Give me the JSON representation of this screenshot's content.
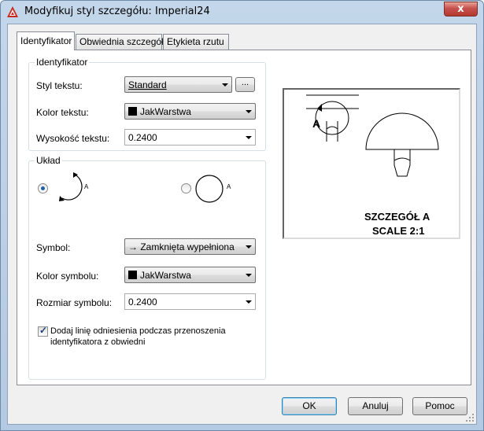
{
  "window": {
    "title": "Modyfikuj styl szczegółu: Imperial24",
    "close_glyph": "x"
  },
  "tabs": [
    {
      "label": "Identyfikator",
      "active": true
    },
    {
      "label": "Obwiednia szczegółu",
      "active": false
    },
    {
      "label": "Etykieta rzutu",
      "active": false
    }
  ],
  "identifier_group": {
    "title": "Identyfikator",
    "text_style_label": "Styl tekstu:",
    "text_style_value": "Standard",
    "browse_label": "...",
    "text_color_label": "Kolor tekstu:",
    "text_color_value": "JakWarstwa",
    "text_height_label": "Wysokość tekstu:",
    "text_height_value": "0.2400"
  },
  "layout_group": {
    "title": "Układ",
    "option1_selected": true,
    "option1_letter": "A",
    "option2_selected": false,
    "option2_letter": "A",
    "symbol_label": "Symbol:",
    "symbol_value": "Zamknięta wypełniona",
    "symbol_color_label": "Kolor symbolu:",
    "symbol_color_value": "JakWarstwa",
    "symbol_size_label": "Rozmiar symbolu:",
    "symbol_size_value": "0.2400",
    "leader_checkbox_checked": true,
    "leader_checkbox_label_line1": "Dodaj linię odniesienia podczas przenoszenia",
    "leader_checkbox_label_line2": "identyfikatora z obwiedni"
  },
  "preview": {
    "marker_letter": "A",
    "caption_line1": "SZCZEGÓŁ A",
    "caption_line2": "SCALE 2:1"
  },
  "buttons": {
    "ok": "OK",
    "cancel": "Anuluj",
    "help": "Pomoc"
  },
  "colors": {
    "accent_selected": "#3c7fb1",
    "close_button": "#c75050",
    "color_swatch": "#000000"
  }
}
